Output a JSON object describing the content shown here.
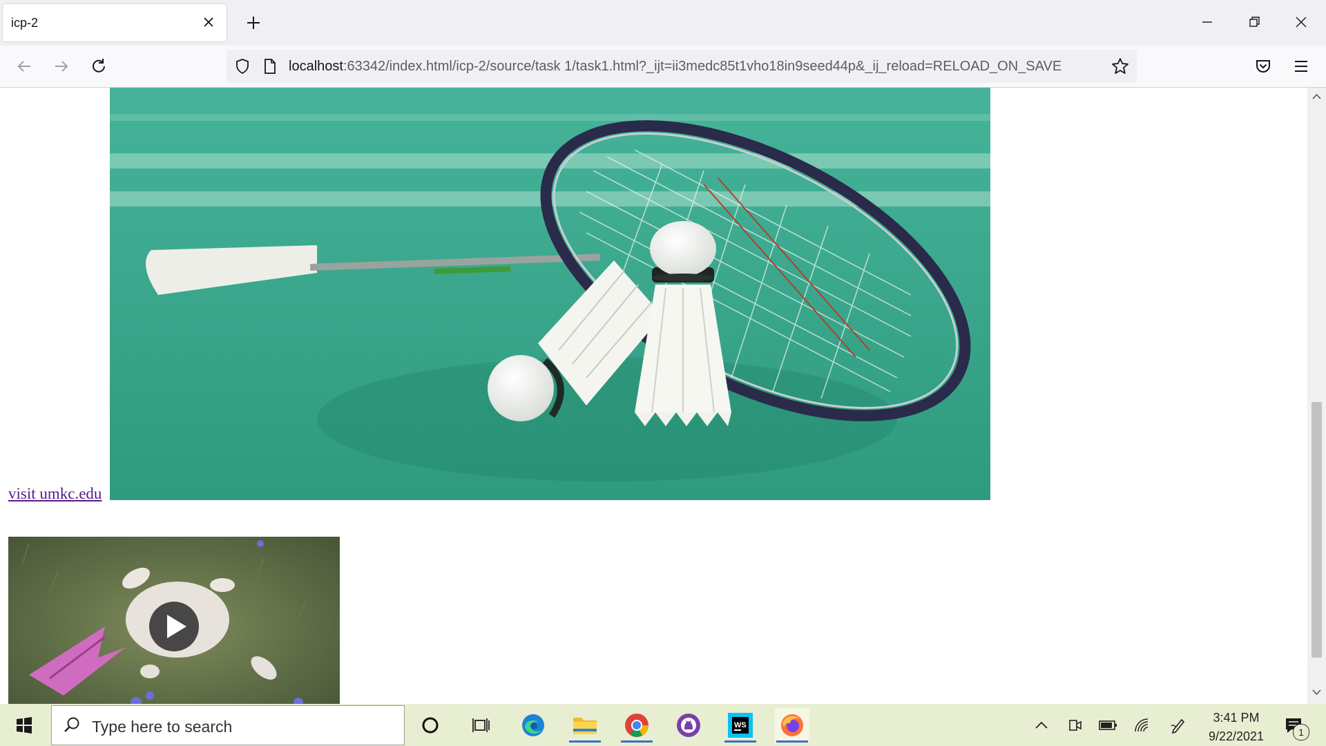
{
  "browser": {
    "tab_title": "icp-2",
    "url_host": "localhost",
    "url_rest": ":63342/index.html/icp-2/source/task 1/task1.html?_ijt=ii3medc85t1vho18in9seed44p&_ij_reload=RELOAD_ON_SAVE"
  },
  "page": {
    "link_text": "visit umkc.edu"
  },
  "taskbar": {
    "search_placeholder": "Type here to search",
    "time": "3:41 PM",
    "date": "9/22/2021",
    "notification_count": "1"
  }
}
